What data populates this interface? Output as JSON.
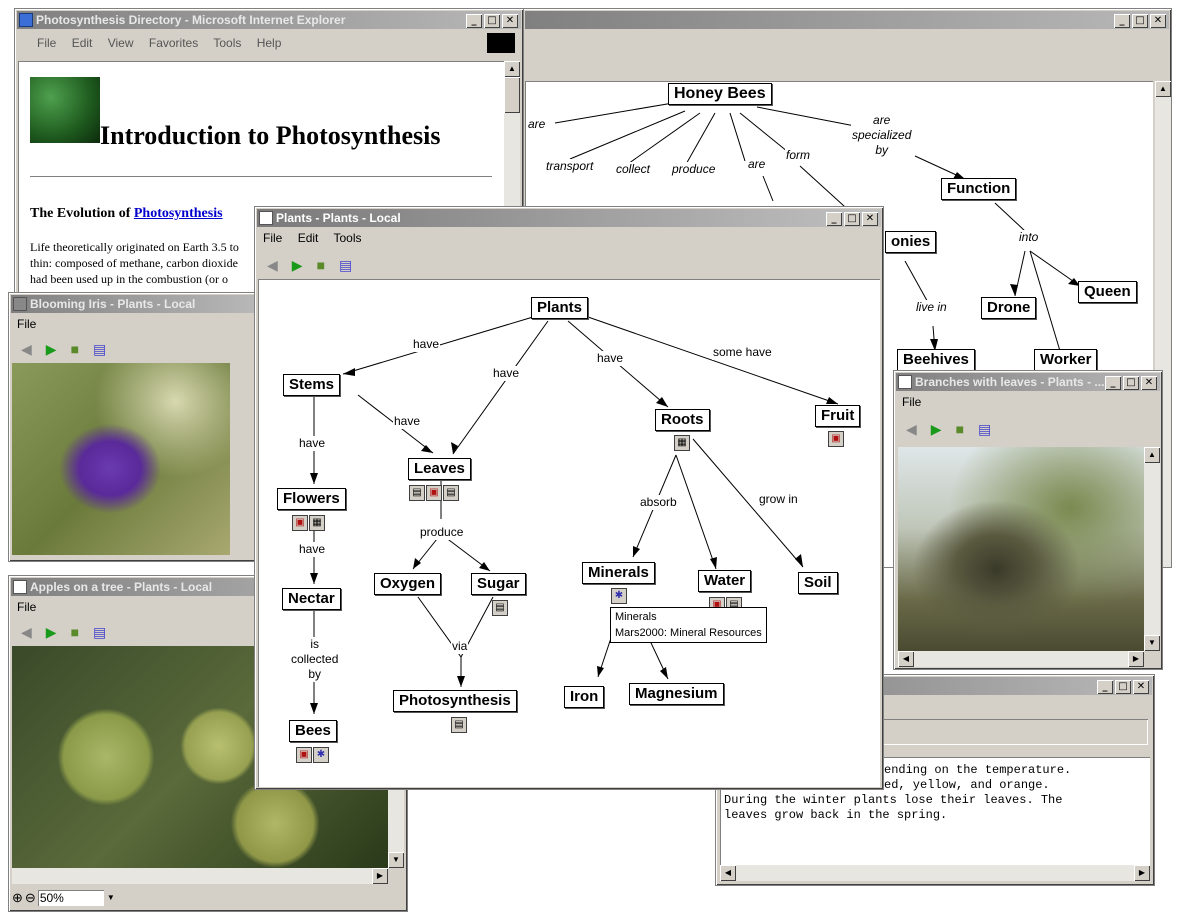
{
  "ie_window": {
    "title": "Photosynthesis Directory - Microsoft Internet Explorer",
    "menu": [
      "File",
      "Edit",
      "View",
      "Favorites",
      "Tools",
      "Help"
    ],
    "page_title": "Introduction to Photosynthesis",
    "section_prefix": "The Evolution of ",
    "section_link": "Photosynthesis",
    "body_lines": [
      "Life theoretically originated on Earth 3.5 to",
      "thin: composed of methane, carbon dioxide",
      "had been used up in the combustion (or o"
    ]
  },
  "bees_window": {
    "root": "Honey Bees",
    "nodes": {
      "function": "Function",
      "colonies": "onies",
      "drone": "Drone",
      "queen": "Queen",
      "beehives": "Beehives",
      "worker": "Worker"
    },
    "links": {
      "are1": "are",
      "transport": "transport",
      "collect": "collect",
      "produce": "produce",
      "are2": "are",
      "form": "form",
      "specialized": [
        "are",
        "specialized",
        "by"
      ],
      "into": "into",
      "live_in": "live in"
    }
  },
  "iris_window": {
    "title": "Blooming Iris - Plants - Local",
    "menu": [
      "File"
    ]
  },
  "apples_window": {
    "title": "Apples on a tree - Plants - Local",
    "menu": [
      "File"
    ],
    "zoom": "50%"
  },
  "plants_window": {
    "title": "Plants - Plants - Local",
    "menu": [
      "File",
      "Edit",
      "Tools"
    ],
    "nodes": {
      "plants": "Plants",
      "stems": "Stems",
      "leaves": "Leaves",
      "roots": "Roots",
      "fruit": "Fruit",
      "flowers": "Flowers",
      "nectar": "Nectar",
      "bees": "Bees",
      "oxygen": "Oxygen",
      "sugar": "Sugar",
      "photosynthesis": "Photosynthesis",
      "minerals": "Minerals",
      "water": "Water",
      "soil": "Soil",
      "iron": "Iron",
      "magnesium": "Magnesium"
    },
    "links": {
      "have1": "have",
      "have2": "have",
      "have3": "have",
      "some_have": "some have",
      "have_stems_leaves": "have",
      "have_stems_flowers": "have",
      "have_flowers_nectar": "have",
      "is_collected_by": [
        "is",
        "collected",
        "by"
      ],
      "produce": "produce",
      "via": "via",
      "absorb": "absorb",
      "grow_in": "grow in"
    },
    "tooltip": [
      "Minerals",
      "Mars2000: Mineral Resources"
    ]
  },
  "branches_window": {
    "title": "Branches with leaves - Plants - ...",
    "menu": [
      "File"
    ]
  },
  "text_window": {
    "lines": [
      "ending on the temperature.",
      "ed, yellow, and orange.",
      "During the winter plants lose their leaves. The",
      "leaves grow back in the spring."
    ]
  },
  "colors": {
    "window_face": "#d4d0c8",
    "link_blue": "#0000cc"
  }
}
